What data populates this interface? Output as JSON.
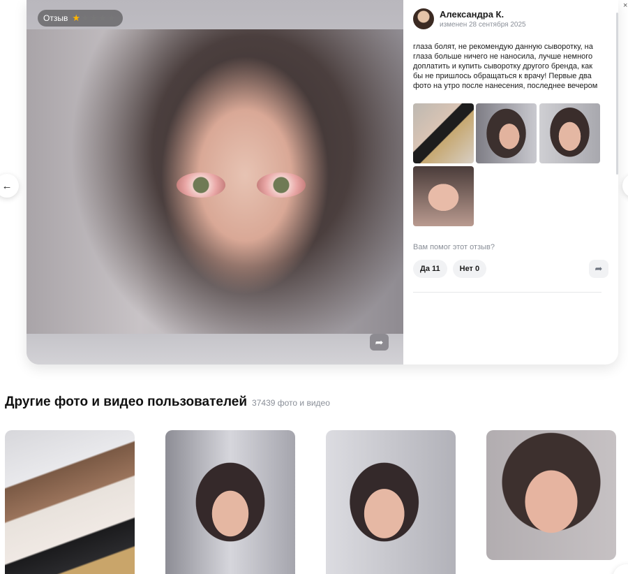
{
  "review": {
    "badge_label": "Отзыв",
    "rating": 1,
    "rating_max": 5,
    "author_name": "Александра К.",
    "author_date": "изменен 28 сентября 2025",
    "text": "глаза болят, не рекомендую данную сыворотку, на глаза больше ничего не наносила, лучше немного доплатить и купить сыворотку другого бренда, как бы не пришлось обращаться к врачу! Первые два фото на утро после нанесения, последнее вечером",
    "helpful_question": "Вам помог этот отзыв?",
    "yes_label": "Да 11",
    "no_label": "Нет 0"
  },
  "icons": {
    "prev": "arrow-left-icon",
    "share": "share-icon",
    "star": "star-icon",
    "close": "close-icon"
  },
  "gallery": {
    "title": "Другие фото и видео пользователей",
    "count": "37439 фото и видео"
  },
  "colors": {
    "star_active": "#ffb400",
    "star_inactive": "#7a7a7a",
    "muted_text": "#8a8f98",
    "chip_bg": "#f1f2f4"
  }
}
